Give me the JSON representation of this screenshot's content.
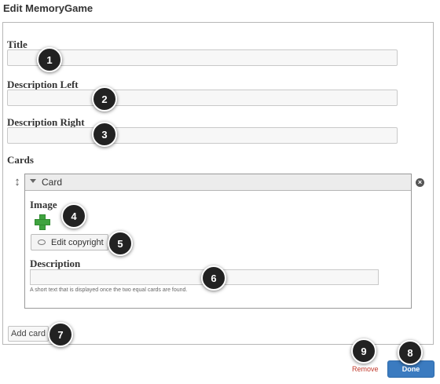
{
  "header": {
    "title": "Edit MemoryGame"
  },
  "fields": {
    "title_label": "Title",
    "title_value": "",
    "description_left_label": "Description Left",
    "description_left_value": "",
    "description_right_label": "Description Right",
    "description_right_value": ""
  },
  "cards": {
    "label": "Cards",
    "card": {
      "header": "Card",
      "image_label": "Image",
      "edit_copyright": "Edit copyright",
      "description_label": "Description",
      "description_value": "",
      "description_hint": "A short text that is displayed once the two equal cards are found."
    },
    "add_button": "Add card"
  },
  "footer": {
    "remove": "Remove",
    "done": "Done"
  },
  "badges": [
    "1",
    "2",
    "3",
    "4",
    "5",
    "6",
    "7",
    "8",
    "9"
  ],
  "colors": {
    "done_button": "#3b7bc0",
    "remove_link": "#c0392b",
    "add_icon": "#3fa33f",
    "badge": "#222222"
  },
  "icons": [
    "drag-handle-icon",
    "chevron-down-icon",
    "remove-circle-icon",
    "plus-icon",
    "eye-icon"
  ]
}
